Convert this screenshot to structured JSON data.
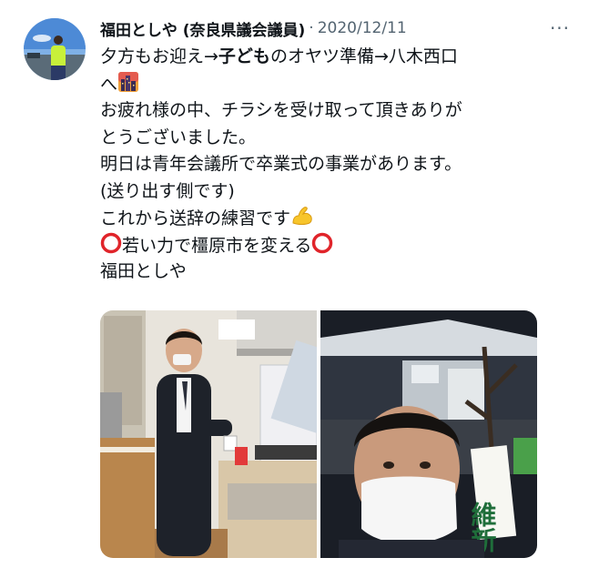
{
  "author": {
    "name": "福田としや (奈良県議会議員)",
    "separator": "·",
    "date": "2020/12/11"
  },
  "more_button": {
    "label": "···"
  },
  "tweet_lines": [
    {
      "pre": "夕方もお迎え→",
      "bold": "子ども",
      "post": "のオヤツ準備→八木西口"
    },
    {
      "text": "へ"
    },
    {
      "text": "お疲れ様の中、チラシを受け取って頂きありが"
    },
    {
      "text": "とうございました。"
    },
    {
      "text": "明日は青年会議所で卒業式の事業があります。"
    },
    {
      "text": "(送り出す側です)"
    },
    {
      "text": "これから送辞の練習です"
    },
    {
      "text": "若い力で橿原市を変える"
    },
    {
      "text": "福田としや"
    }
  ],
  "icons": {
    "avatar": "avatar-photo",
    "more": "more-horizontal-icon",
    "emoji_night": "night-city-emoji",
    "emoji_muscle": "flexed-biceps-emoji",
    "emoji_circle": "red-circle-emoji"
  },
  "media": {
    "photo_left": "kitchen-photo",
    "photo_right": "station-selfie-photo",
    "banner_text": "維新"
  },
  "colors": {
    "text": "#0f1419",
    "secondary": "#536471",
    "red_circle": "#e0242a"
  }
}
